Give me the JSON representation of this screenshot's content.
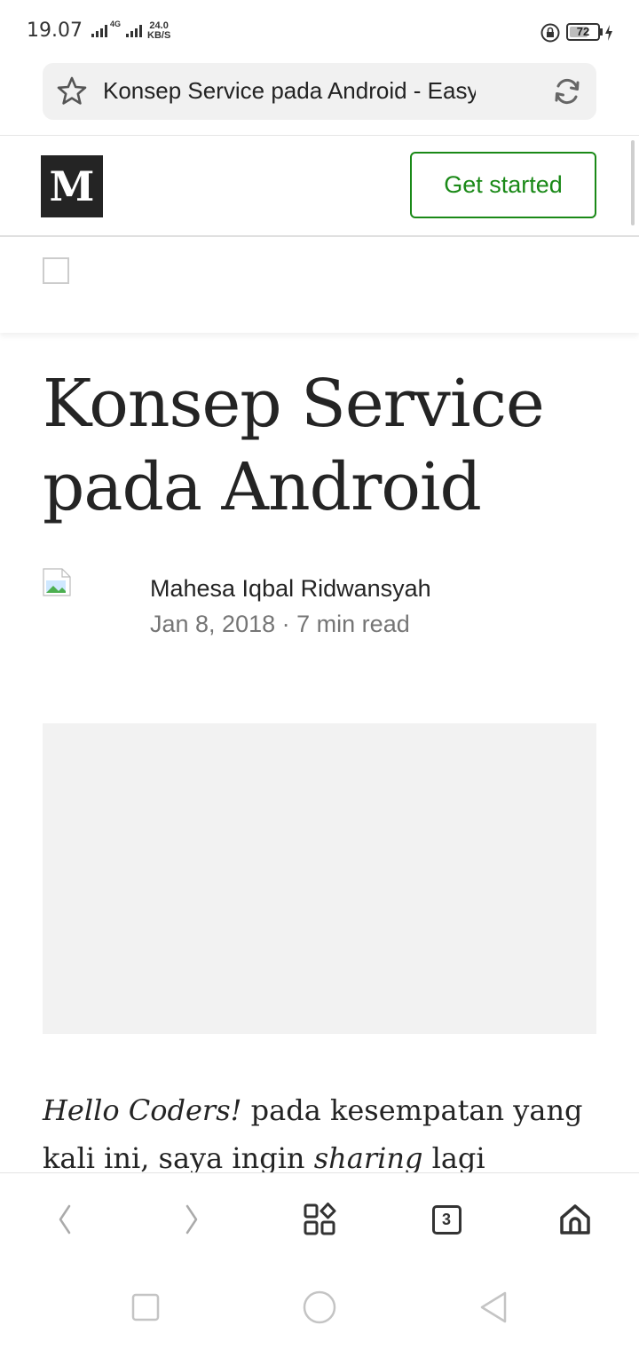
{
  "status_bar": {
    "time": "19.07",
    "network_speed_value": "24.0",
    "network_speed_unit": "KB/S",
    "network_type": "4G",
    "battery_level": 72,
    "battery_text": "72"
  },
  "browser": {
    "page_title": "Konsep Service pada Android - Easyr...",
    "open_tabs": "3"
  },
  "medium_header": {
    "logo_text": "M",
    "cta_label": "Get started"
  },
  "article": {
    "title": "Konsep Service pada Android",
    "author": "Mahesa Iqbal Ridwansyah",
    "date": "Jan 8, 2018",
    "separator": "·",
    "read_time": "7 min read",
    "intro": {
      "greeting": "Hello Coders!",
      "part1": " pada kesempatan yang kali ini, saya ingin ",
      "emph": "sharing",
      "part2": " lagi tentang"
    }
  },
  "colors": {
    "accent_green": "#1a8917",
    "text_dark": "#242424",
    "text_muted": "#757575",
    "placeholder_gray": "#f2f2f2"
  },
  "icons": {
    "bookmark": "star-icon",
    "reload": "refresh-icon",
    "back": "chevron-left-icon",
    "forward": "chevron-right-icon",
    "apps": "apps-grid-icon",
    "tabs": "tabs-icon",
    "home": "home-icon"
  }
}
